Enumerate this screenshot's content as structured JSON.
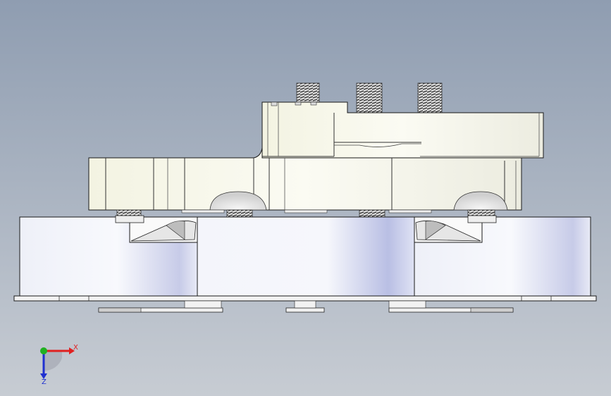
{
  "viewport": {
    "background_top": "#8f9db1",
    "background_bottom": "#c7ccd3",
    "part_color_light": "#f7f7ee",
    "part_color_mid": "#e9e9d8",
    "cylinder_light": "#f4f5fb",
    "cylinder_shade": "#c9cde8",
    "edge_color": "#1a1a1a"
  },
  "triad": {
    "x_label": "X",
    "z_label": "Z",
    "x_color": "#e02020",
    "z_color": "#2030d0",
    "y_color": "#20b020"
  }
}
